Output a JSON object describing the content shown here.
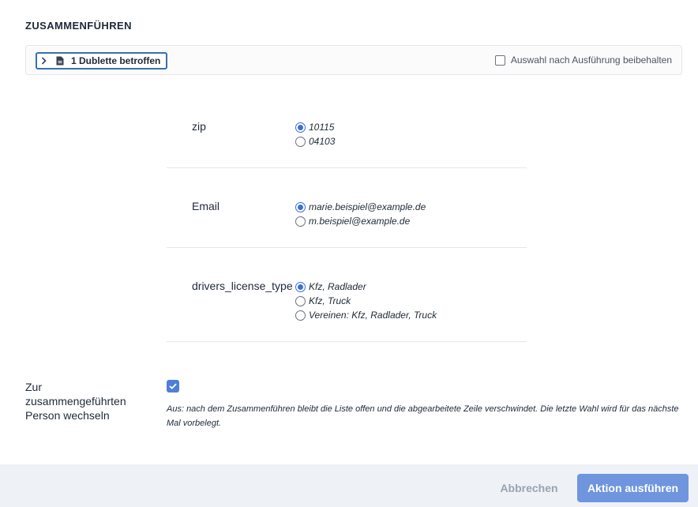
{
  "dialog": {
    "title": "ZUSAMMENFÜHREN"
  },
  "affected": {
    "label": "1 Dublette betroffen",
    "keep_selection_label": "Auswahl nach Ausführung beibehalten",
    "keep_selection_checked": false
  },
  "fields": [
    {
      "label": "zip",
      "options": [
        {
          "value": "10115",
          "checked": true
        },
        {
          "value": "04103",
          "checked": false
        }
      ]
    },
    {
      "label": "Email",
      "options": [
        {
          "value": "marie.beispiel@example.de",
          "checked": true
        },
        {
          "value": "m.beispiel@example.de",
          "checked": false
        }
      ]
    },
    {
      "label": "drivers_license_type",
      "options": [
        {
          "value": "Kfz, Radlader",
          "checked": true
        },
        {
          "value": "Kfz, Truck",
          "checked": false
        },
        {
          "value": "Vereinen: Kfz, Radlader, Truck",
          "checked": false
        }
      ]
    }
  ],
  "switch_person": {
    "label": "Zur zusammengeführten Person wechseln",
    "checked": true,
    "help": "Aus: nach dem Zusammenführen bleibt die Liste offen und die abgearbeitete Zeile verschwindet. Die letzte Wahl wird für das nächste Mal vorbelegt."
  },
  "footer": {
    "cancel_label": "Abbrechen",
    "submit_label": "Aktion ausführen"
  },
  "colors": {
    "accent": "#6f95de",
    "radio_checked": "#3b6fd8",
    "footer_bg": "#eef1f6",
    "focus_border": "#3a6fb0"
  }
}
